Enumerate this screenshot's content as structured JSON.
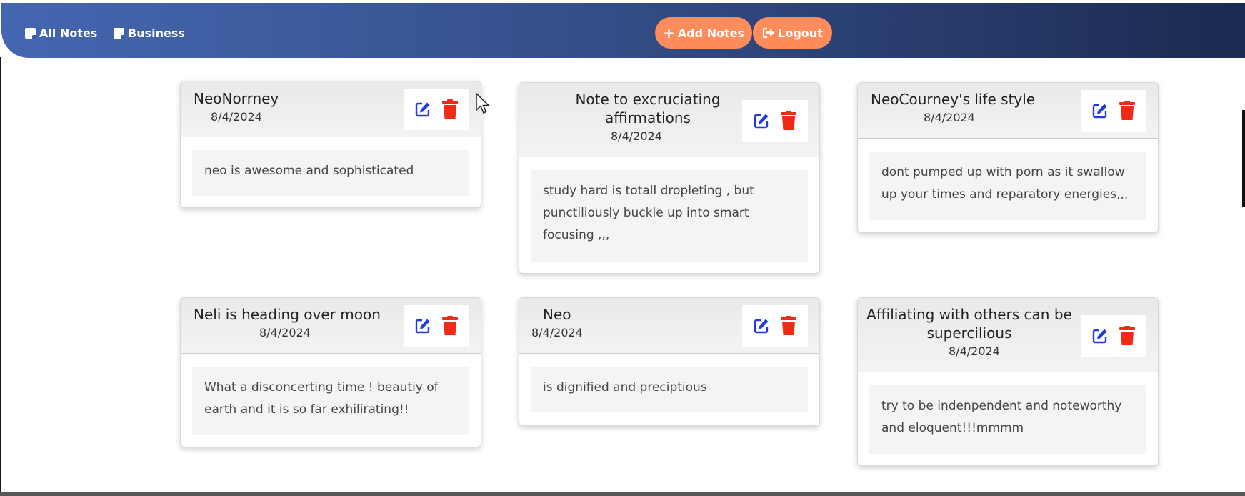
{
  "nav": {
    "all_notes": "All Notes",
    "business": "Business",
    "add_notes": "Add Notes",
    "logout": "Logout"
  },
  "colors": {
    "navbar_start": "#4567b2",
    "navbar_end": "#1b2a50",
    "pill": "#ff8c5a",
    "edit": "#1f3be0",
    "delete": "#f02a14"
  },
  "icons": {
    "edit": "edit-icon",
    "delete": "trash-icon",
    "note": "sticky-note-icon",
    "logout": "logout-icon"
  },
  "notes": [
    {
      "title": "NeoNorrney",
      "date": "8/4/2024",
      "body": "neo is awesome and sophisticated"
    },
    {
      "title": "Note to excruciating affirmations",
      "date": "8/4/2024",
      "body": "study hard is totall dropleting , but punctiliously buckle up into smart focusing ,,,"
    },
    {
      "title": "NeoCourney's life style",
      "date": "8/4/2024",
      "body": "dont pumped up with porn as it swallow up your times and reparatory energies,,,"
    },
    {
      "title": "Neli is heading over moon",
      "date": "8/4/2024",
      "body": "What a disconcerting time ! beautiy of earth and it is so far exhilirating!!"
    },
    {
      "title": "Neo",
      "date": "8/4/2024",
      "body": "is dignified and preciptious"
    },
    {
      "title": "Affiliating with others can be supercilious",
      "date": "8/4/2024",
      "body": "try to be indenpendent and noteworthy and eloquent!!!mmmm"
    }
  ]
}
